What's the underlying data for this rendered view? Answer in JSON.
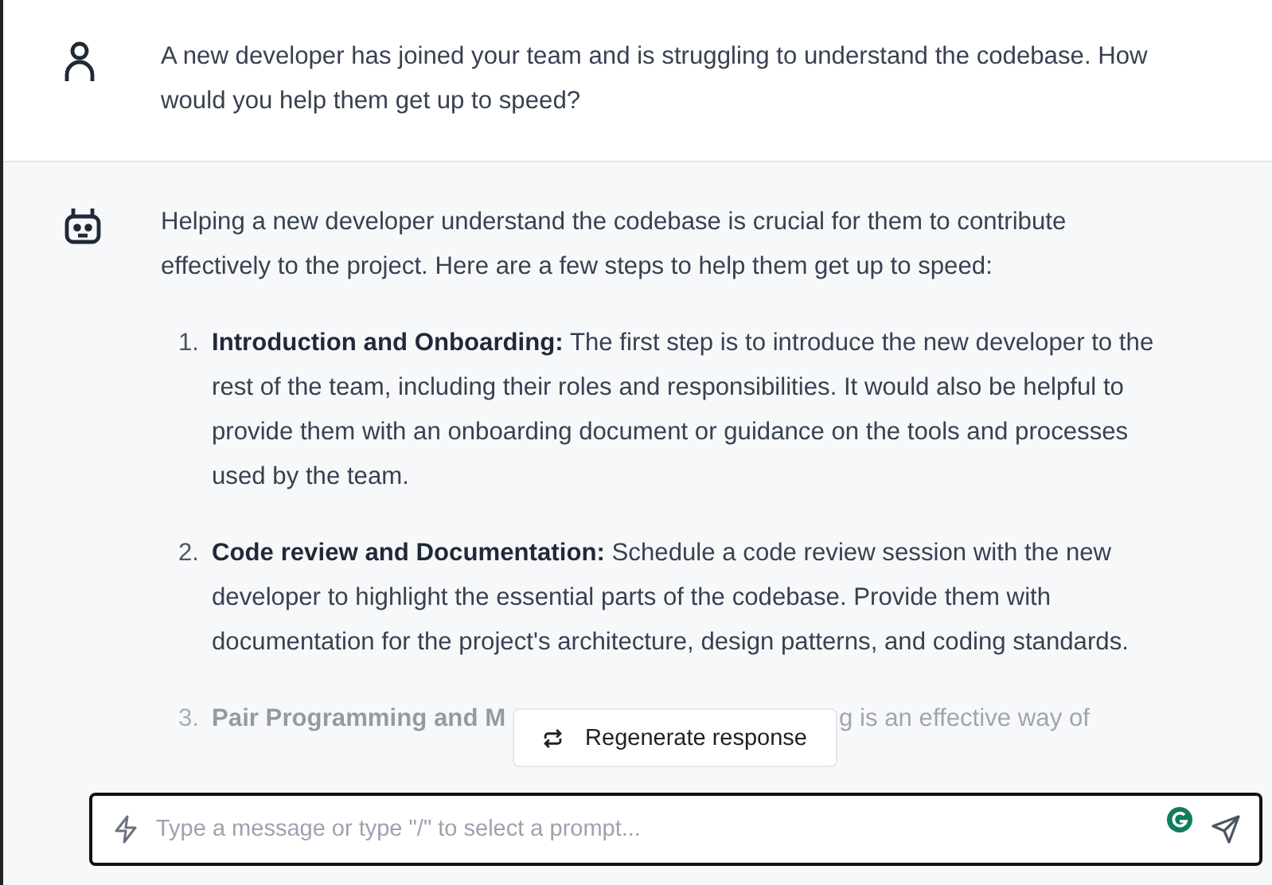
{
  "messages": [
    {
      "kind": "user",
      "text": "A new developer has joined your team and is struggling to understand the codebase. How would you help them get up to speed?"
    },
    {
      "kind": "assistant",
      "text": "Helping a new developer understand the codebase is crucial for them to contribute effectively to the project. Here are a few steps to help them get up to speed:",
      "items": [
        {
          "kind": "full",
          "number": "1.",
          "title": "Introduction and Onboarding:",
          "text": "The first step is to introduce the new developer to the rest of the team, including their roles and responsibilities. It would also be helpful to provide them with an onboarding document or guidance on the tools and processes used by the team."
        },
        {
          "kind": "full",
          "number": "2.",
          "title": "Code review and Documentation:",
          "text": "Schedule a code review session with the new developer to highlight the essential parts of the codebase. Provide them with documentation for the project's architecture, design patterns, and coding standards."
        },
        {
          "kind": "covered",
          "number": "3.",
          "title": "Pair Programming and M",
          "text": "g is an effective way of"
        }
      ]
    }
  ],
  "regenerate_button": "Regenerate response",
  "composer": {
    "placeholder": "Type a message or type \"/\" to select a prompt..."
  }
}
